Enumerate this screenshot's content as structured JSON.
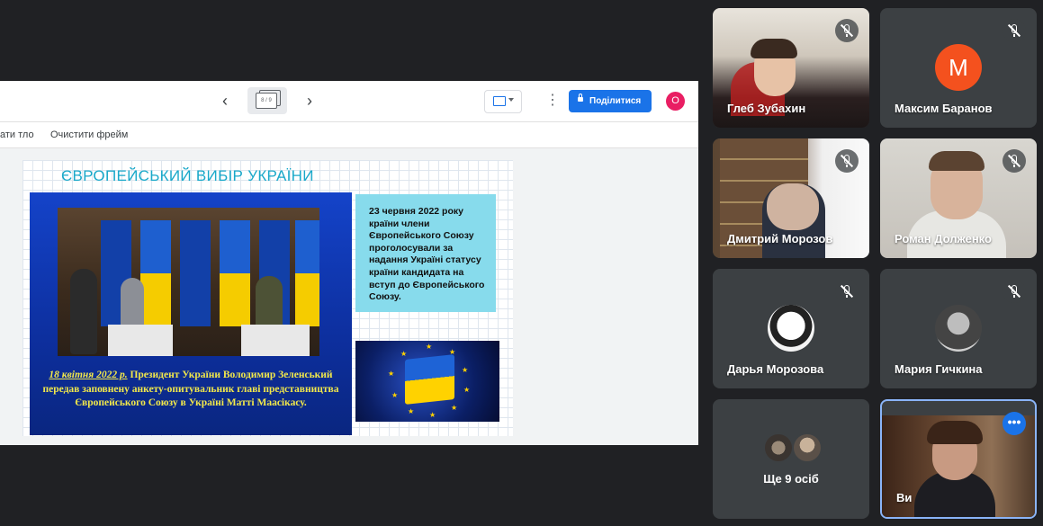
{
  "presentation": {
    "page_indicator": "8 / 9",
    "share_button_label": "Поділитися",
    "account_initial": "О",
    "subbar": {
      "item1": "ати тло",
      "item2": "Очистити фрейм"
    },
    "slide": {
      "title": "ЄВРОПЕЙСЬКИЙ ВИБІР УКРАЇНИ",
      "info_text": "23 червня 2022 року країни члени Європейського Союзу проголосували за надання Україні статусу країни кандидата на вступ до Європейського Союзу.",
      "caption_date": "18 квітня 2022 р.",
      "caption_text": " Президент України Володимир Зеленський передав заповнену анкету-опитувальник главі представництва Європейського Союзу в Україні Матті Маасікасу."
    }
  },
  "participants": {
    "tile1": "Глеб Зубахин",
    "tile2": "Максим Баранов",
    "tile2_initial": "M",
    "tile3": "Дмитрий Морозов",
    "tile4": "Роман Долженко",
    "tile5": "Дарья Морозова",
    "tile6": "Мария Гичкина",
    "tile7": "Ще 9 осіб",
    "tile8": "Ви"
  },
  "colors": {
    "meet_background": "#202124",
    "tile_background": "#3c4043",
    "accent_blue": "#1a73e8",
    "avatar_orange": "#f4511e"
  }
}
